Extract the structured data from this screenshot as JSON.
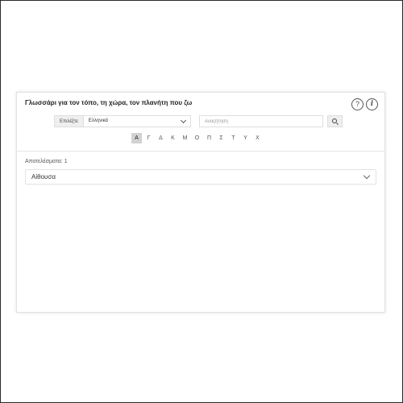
{
  "header": {
    "title": "Γλωσσάρι για τον τόπο, τη χώρα, τον πλανήτη που ζω",
    "help_glyph": "?",
    "info_glyph": "i"
  },
  "controls": {
    "language_label": "Επιλέξτε",
    "language_value": "Ελληνικά",
    "search_placeholder": "Αναζήτηση",
    "search_value": ""
  },
  "alphabet": {
    "letters": [
      "Α",
      "Γ",
      "Δ",
      "Κ",
      "Μ",
      "Ο",
      "Π",
      "Σ",
      "Τ",
      "Υ",
      "Χ"
    ],
    "active_letter": "Α"
  },
  "results": {
    "label": "Αποτελέσματα: 1",
    "items": [
      {
        "label": "Αίθουσα"
      }
    ]
  },
  "icons": {
    "help": "help-circle-icon",
    "info": "info-circle-icon",
    "language_chevron": "chevron-down-icon",
    "search": "search-icon",
    "expand": "chevron-down-icon"
  },
  "colors": {
    "active_letter_background": "#d2d2d2",
    "border": "#dedede",
    "text": "#333333"
  }
}
